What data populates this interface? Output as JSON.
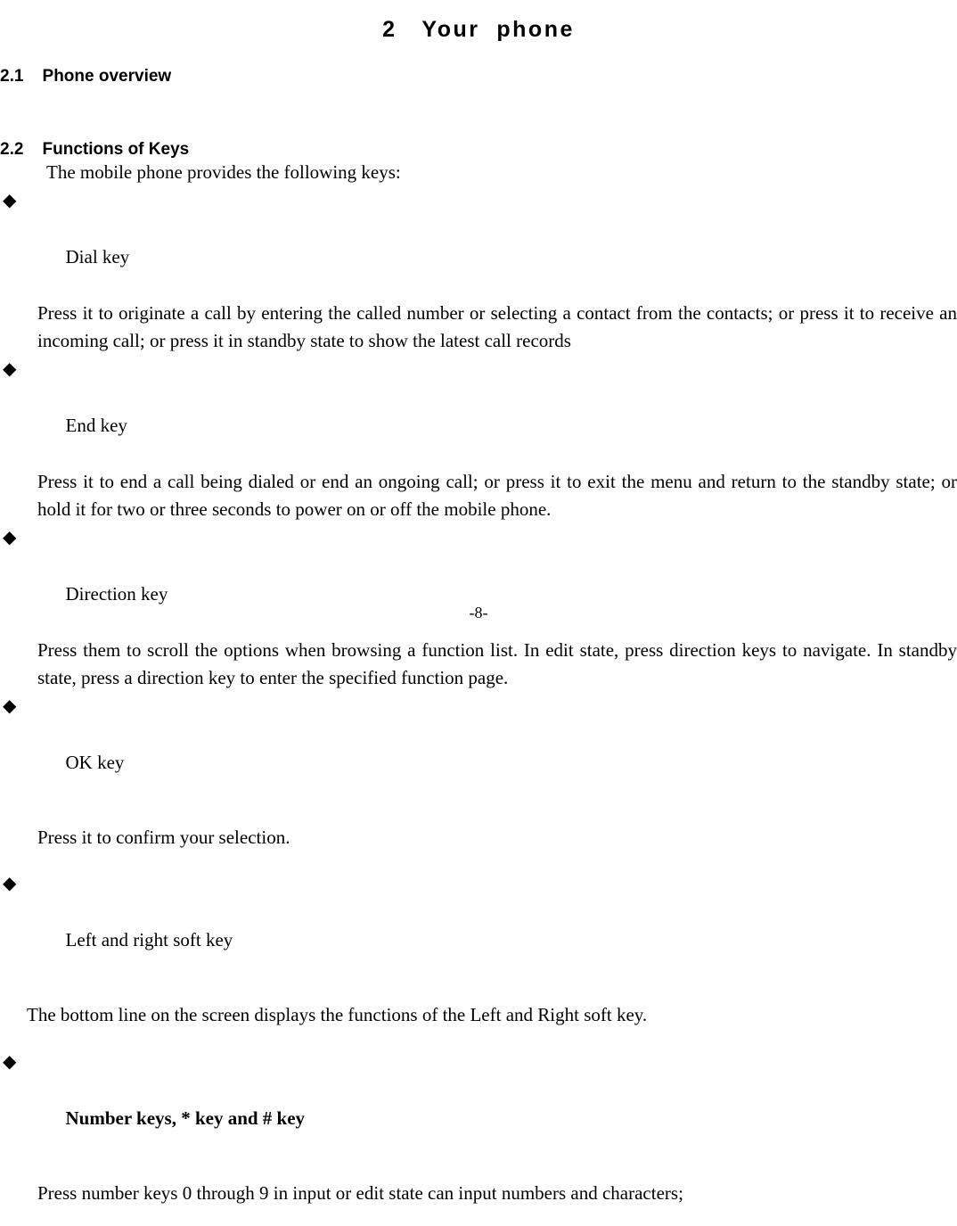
{
  "document": {
    "chapter_title": "2   Your  phone",
    "page_number_label": "-8-"
  },
  "sections": {
    "overview": {
      "number": "2.1",
      "title": "Phone overview",
      "heading": "2.1    Phone overview"
    },
    "functions": {
      "number": "2.2",
      "title": "Functions of Keys",
      "heading": "2.2    Functions of Keys",
      "lead": "The mobile phone provides the following keys:"
    }
  },
  "bullet_glyph": "◆",
  "keys": [
    {
      "label": "Dial key",
      "bold_label": false,
      "description": "Press it to originate a call by entering the called number or selecting a contact from the contacts; or press it to receive an incoming call; or press it in standby state to show the latest call records"
    },
    {
      "label": "End key",
      "bold_label": false,
      "description": "Press it to end a call being dialed or end an ongoing call; or press it to exit the menu and return to the standby state; or hold it for two or three seconds to power on or off the mobile phone."
    },
    {
      "label": "Direction key",
      "bold_label": false,
      "description": "Press them to scroll the options when browsing a function list. In edit state, press direction keys to navigate. In standby state, press a direction key to enter the specified function page."
    },
    {
      "label": "OK key",
      "bold_label": false,
      "description": "Press it to confirm your selection."
    },
    {
      "label": "Left and right soft key",
      "bold_label": false,
      "description": "The bottom line on the screen displays the functions of the Left and Right soft key."
    },
    {
      "label": "Number keys, * key and # key",
      "bold_label": true,
      "description": "Press number keys 0 through 9 in input or edit state can input numbers and characters;"
    }
  ],
  "colors": {
    "text": "#000000",
    "background": "#ffffff"
  }
}
